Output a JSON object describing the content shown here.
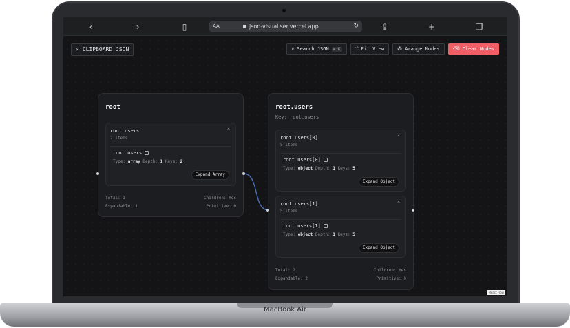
{
  "device": {
    "brand_label": "MacBook Air"
  },
  "browser": {
    "url": "json-visualiser.vercel.app",
    "text_size_label": "AA"
  },
  "app": {
    "file_chip": "CLIPBOARD.JSON",
    "actions": {
      "search_label": "Search JSON",
      "search_shortcut": "⌘ K",
      "fit_view_label": "Fit View",
      "arrange_label": "Arange Nodes",
      "clear_label": "Clear Nodes"
    },
    "attribution": "React Flow"
  },
  "nodes": {
    "root": {
      "title": "root",
      "section": {
        "title": "root.users",
        "count": "2 items",
        "path": "root.users",
        "type_label": "Type:",
        "type": "array",
        "depth_label": "Depth:",
        "depth": "1",
        "keys_label": "Keys:",
        "keys": "2",
        "expand": "Expand Array"
      },
      "stats": {
        "total": "Total: 1",
        "children": "Children: Yes",
        "expandable": "Expandable: 1",
        "primitive": "Primitive: 0"
      }
    },
    "users": {
      "title": "root.users",
      "key": "Key: root.users",
      "sections": [
        {
          "title": "root.users[0]",
          "count": "5 items",
          "path": "root.users[0]",
          "type_label": "Type:",
          "type": "object",
          "depth_label": "Depth:",
          "depth": "1",
          "keys_label": "Keys:",
          "keys": "5",
          "expand": "Expand Object"
        },
        {
          "title": "root.users[1]",
          "count": "5 items",
          "path": "root.users[1]",
          "type_label": "Type:",
          "type": "object",
          "depth_label": "Depth:",
          "depth": "1",
          "keys_label": "Keys:",
          "keys": "5",
          "expand": "Expand Object"
        }
      ],
      "stats": {
        "total": "Total: 2",
        "children": "Children: Yes",
        "expandable": "Expandable: 2",
        "primitive": "Primitive: 0"
      }
    }
  },
  "colors": {
    "danger": "#ef5f65",
    "edge": "#4a6fb5",
    "canvas": "#141416"
  }
}
